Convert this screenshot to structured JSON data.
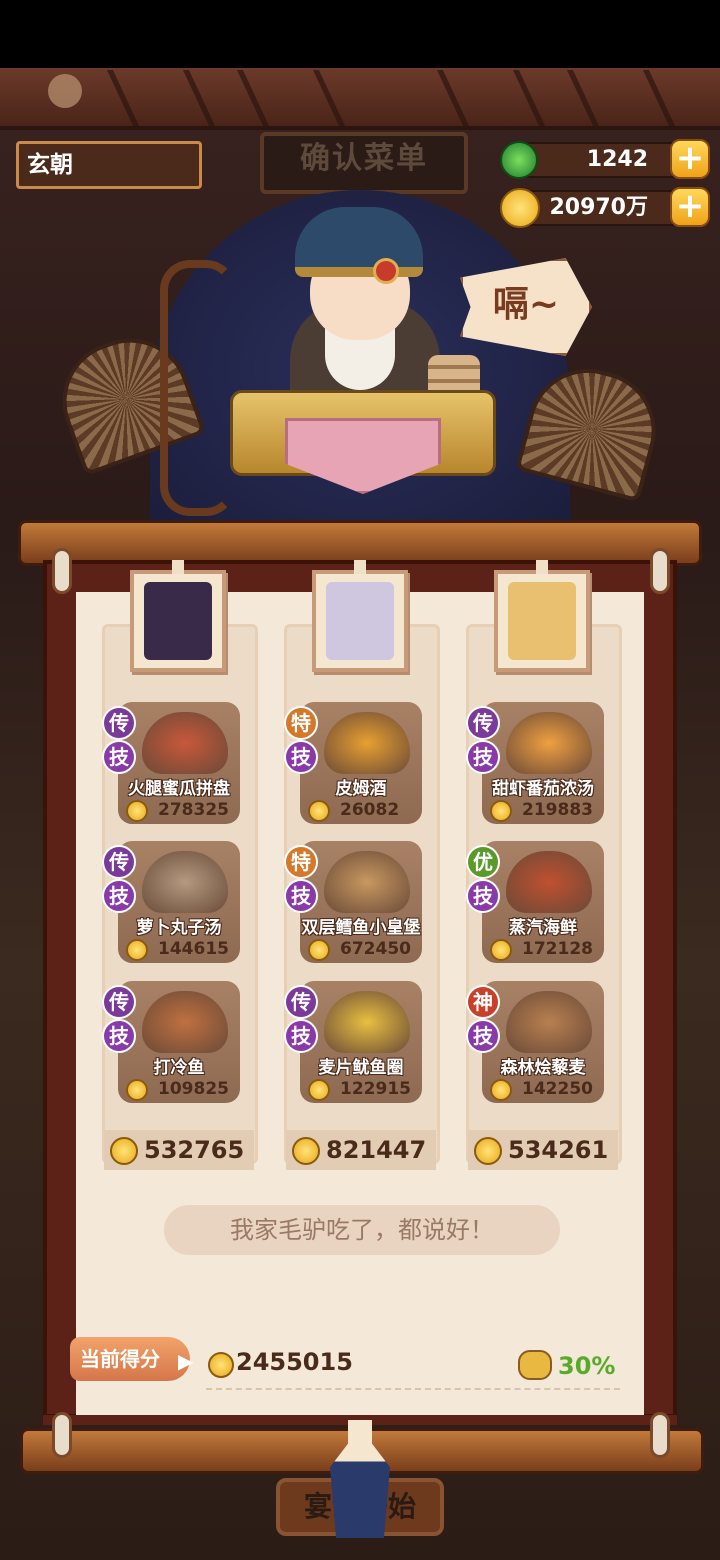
{
  "player": {
    "name": "玄朝"
  },
  "screen_title": "确认菜单",
  "currency": {
    "jade": "1242",
    "coins": "20970万",
    "plus": "+"
  },
  "speech": "嗝~",
  "columns": [
    {
      "dishes": [
        {
          "rank": "传",
          "rank_color": "#7b3a9a",
          "skill": "技",
          "name": "火腿蜜瓜拼盘",
          "value": "278325",
          "color": "#c8583a"
        },
        {
          "rank": "传",
          "rank_color": "#7b3a9a",
          "skill": "技",
          "name": "萝卜丸子汤",
          "value": "144615",
          "color": "#b49a80"
        },
        {
          "rank": "传",
          "rank_color": "#7b3a9a",
          "skill": "技",
          "name": "打冷鱼",
          "value": "109825",
          "color": "#c07040"
        }
      ],
      "total": "532765",
      "portrait_color": "#3a2a4a"
    },
    {
      "dishes": [
        {
          "rank": "特",
          "rank_color": "#d4782a",
          "skill": "技",
          "name": "皮姆酒",
          "value": "26082",
          "color": "#e8a030"
        },
        {
          "rank": "特",
          "rank_color": "#d4782a",
          "skill": "技",
          "name": "双层鳕鱼小皇堡",
          "value": "672450",
          "color": "#c89860"
        },
        {
          "rank": "传",
          "rank_color": "#7b3a9a",
          "skill": "技",
          "name": "麦片鱿鱼圈",
          "value": "122915",
          "color": "#e8c040"
        }
      ],
      "total": "821447",
      "portrait_color": "#cfc6e0"
    },
    {
      "dishes": [
        {
          "rank": "传",
          "rank_color": "#7b3a9a",
          "skill": "技",
          "name": "甜虾番茄浓汤",
          "value": "219883",
          "color": "#f0a040"
        },
        {
          "rank": "优",
          "rank_color": "#5a9a2a",
          "skill": "技",
          "name": "蒸汽海鲜",
          "value": "172128",
          "color": "#c05030"
        },
        {
          "rank": "神",
          "rank_color": "#c8402a",
          "skill": "技",
          "name": "森林烩藜麦",
          "value": "142250",
          "color": "#b88050"
        }
      ],
      "total": "534261",
      "portrait_color": "#e8c070"
    }
  ],
  "comment": "我家毛驴吃了，都说好！",
  "score": {
    "label": "当前得分",
    "value": "2455015",
    "bonus": "30%"
  },
  "start_button": "宴会开始"
}
